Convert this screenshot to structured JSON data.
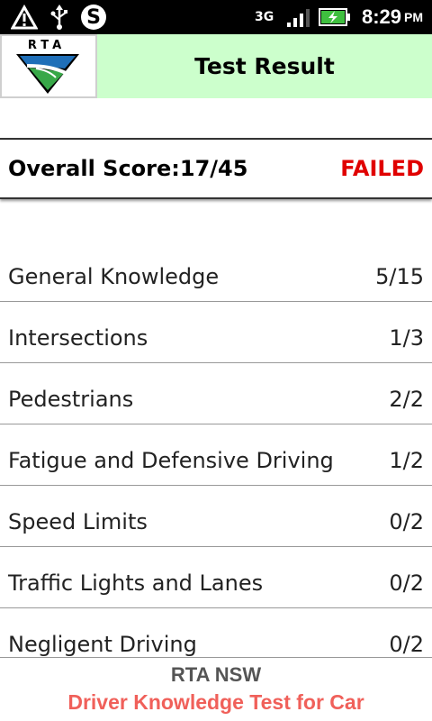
{
  "status_bar": {
    "network": "3G",
    "time": "8:29",
    "ampm": "PM"
  },
  "header": {
    "logo_text": "RTA",
    "title": "Test Result"
  },
  "summary": {
    "score_label": "Overall Score:17/45",
    "result": "FAILED",
    "result_color": "#e00000"
  },
  "categories": [
    {
      "name": "General Knowledge",
      "score": "5/15"
    },
    {
      "name": "Intersections",
      "score": "1/3"
    },
    {
      "name": "Pedestrians",
      "score": "2/2"
    },
    {
      "name": "Fatigue and Defensive Driving",
      "score": "1/2"
    },
    {
      "name": "Speed Limits",
      "score": "0/2"
    },
    {
      "name": "Traffic Lights and Lanes",
      "score": "0/2"
    },
    {
      "name": "Negligent Driving",
      "score": "0/2"
    }
  ],
  "footer": {
    "line1": "RTA NSW",
    "line2": "Driver Knowledge Test for Car"
  },
  "colors": {
    "title_bg": "#ccffcc",
    "footer_accent": "#f0605a"
  }
}
